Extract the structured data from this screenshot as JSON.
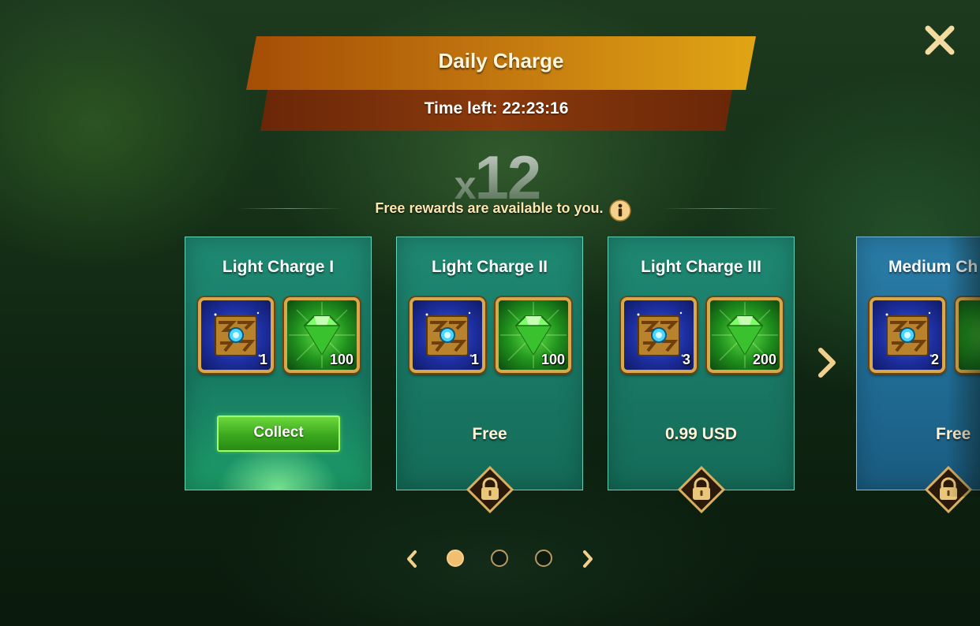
{
  "header": {
    "title": "Daily Charge",
    "time_left": "Time left: 22:23:16",
    "close_icon": "close-icon"
  },
  "multiplier": {
    "prefix": "x",
    "value": "12"
  },
  "free_notice": {
    "text": "Free rewards are available to you.",
    "icon": "info-icon"
  },
  "cards": [
    {
      "title": "Light Charge I",
      "items": [
        {
          "icon": "rune-cube-icon",
          "count": "1"
        },
        {
          "icon": "emerald-icon",
          "count": "100"
        }
      ],
      "action": "Collect",
      "locked": false
    },
    {
      "title": "Light Charge II",
      "items": [
        {
          "icon": "rune-cube-icon",
          "count": "1"
        },
        {
          "icon": "emerald-icon",
          "count": "100"
        }
      ],
      "price": "Free",
      "locked": true
    },
    {
      "title": "Light Charge III",
      "items": [
        {
          "icon": "rune-cube-icon",
          "count": "3"
        },
        {
          "icon": "emerald-icon",
          "count": "200"
        }
      ],
      "price": "0.99 USD",
      "locked": true
    },
    {
      "title": "Medium Ch",
      "items": [
        {
          "icon": "rune-cube-icon",
          "count": "2"
        }
      ],
      "price": "Free",
      "locked": true
    }
  ],
  "pagination": {
    "pages": 3,
    "current": 1
  },
  "colors": {
    "accent_gold": "#e0a515",
    "banner_brown": "#8a3a0c",
    "card_teal": "#1a7a66",
    "collect_green": "#3aa81d"
  }
}
